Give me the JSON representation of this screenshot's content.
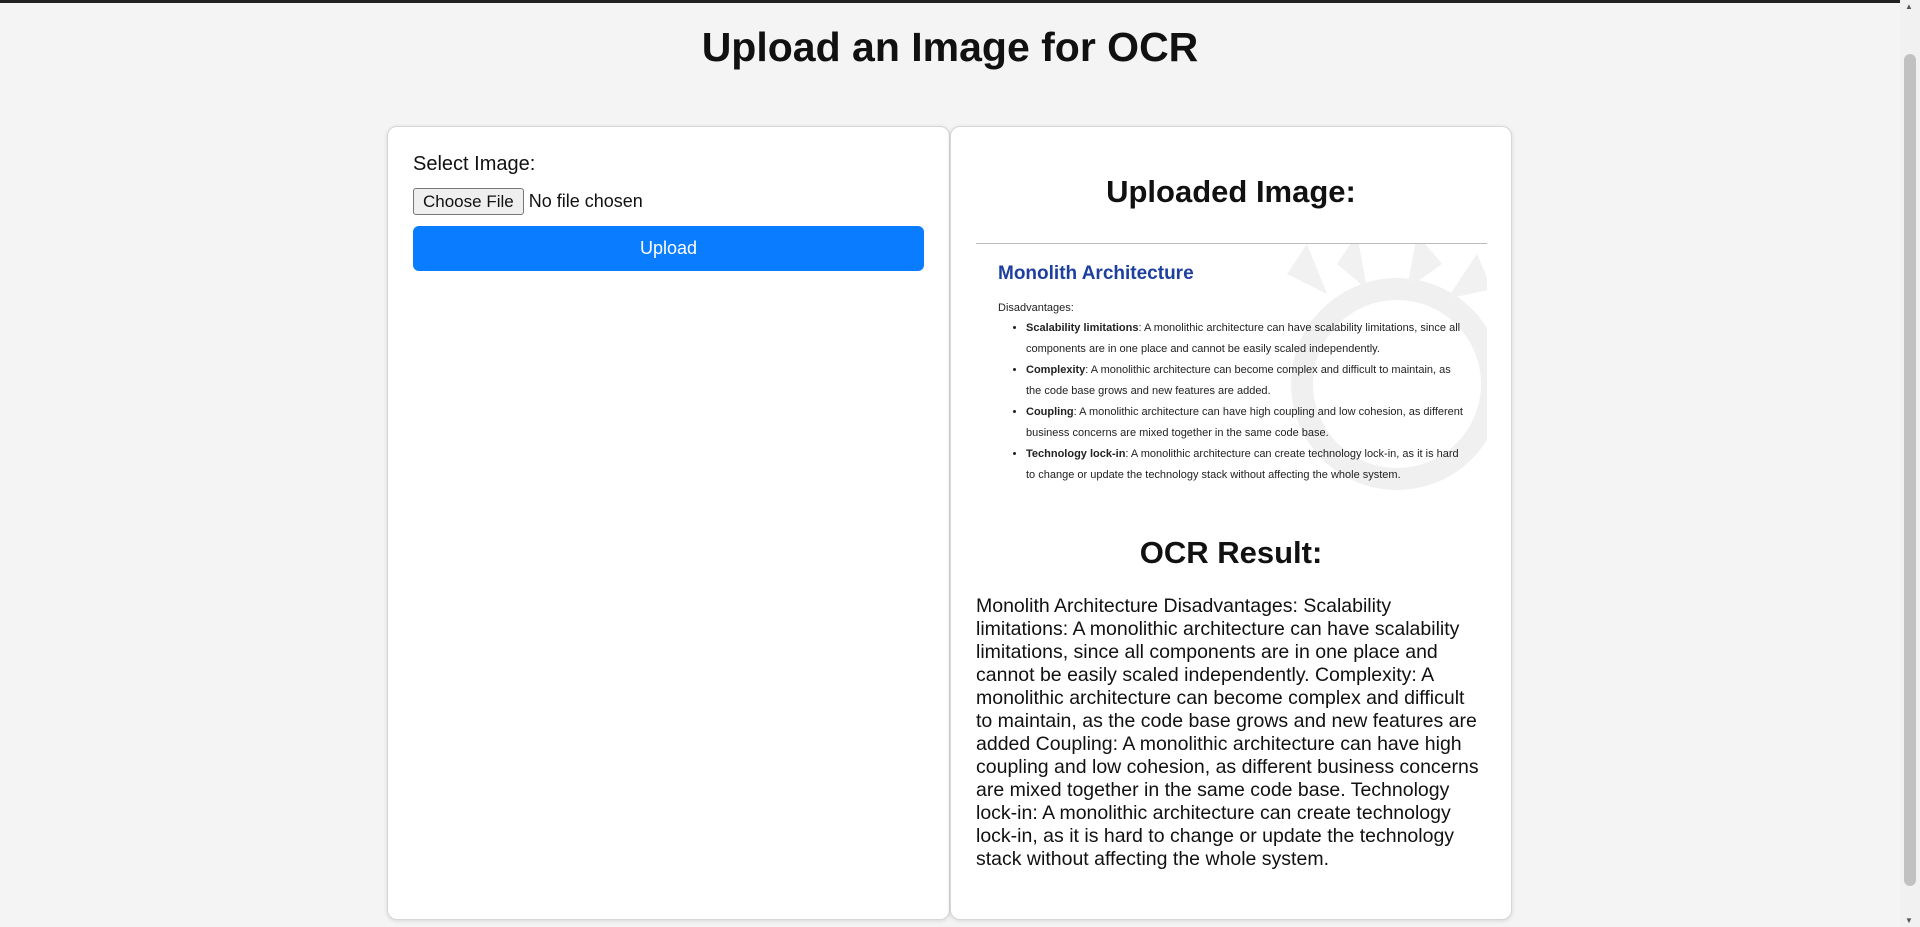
{
  "page": {
    "title": "Upload an Image for OCR"
  },
  "form": {
    "select_label": "Select Image:",
    "choose_file_label": "Choose File",
    "file_status": "No file chosen",
    "upload_label": "Upload"
  },
  "result": {
    "uploaded_title": "Uploaded Image:",
    "preview": {
      "heading": "Monolith Architecture",
      "subheading": "Disadvantages:",
      "items": [
        {
          "term": "Scalability limitations",
          "text": ": A monolithic architecture can have scalability limitations, since all components are in one place and cannot be easily scaled independently."
        },
        {
          "term": "Complexity",
          "text": ": A monolithic architecture can become complex and difficult to maintain, as the code base grows and new features are added."
        },
        {
          "term": "Coupling",
          "text": ": A monolithic architecture can have high coupling and low cohesion, as different business concerns are mixed together in the same code base."
        },
        {
          "term": "Technology lock-in",
          "text": ": A monolithic architecture can create technology lock-in, as it is hard to change or update the technology stack without affecting the whole system."
        }
      ]
    },
    "ocr_title": "OCR Result:",
    "ocr_text": "Monolith Architecture Disadvantages: Scalability limitations: A monolithic architecture can have scalability limitations, since all components are in one place and cannot be easily scaled independently. Complexity: A monolithic architecture can become complex and difficult to maintain, as the code base grows and new features are added Coupling: A monolithic architecture can have high coupling and low cohesion, as different business concerns are mixed together in the same code base. Technology lock-in: A monolithic architecture can create technology lock-in, as it is hard to change or update the technology stack without affecting the whole system."
  },
  "colors": {
    "accent": "#0a7cff",
    "preview_heading": "#1d3f9e",
    "background": "#f4f4f4"
  }
}
